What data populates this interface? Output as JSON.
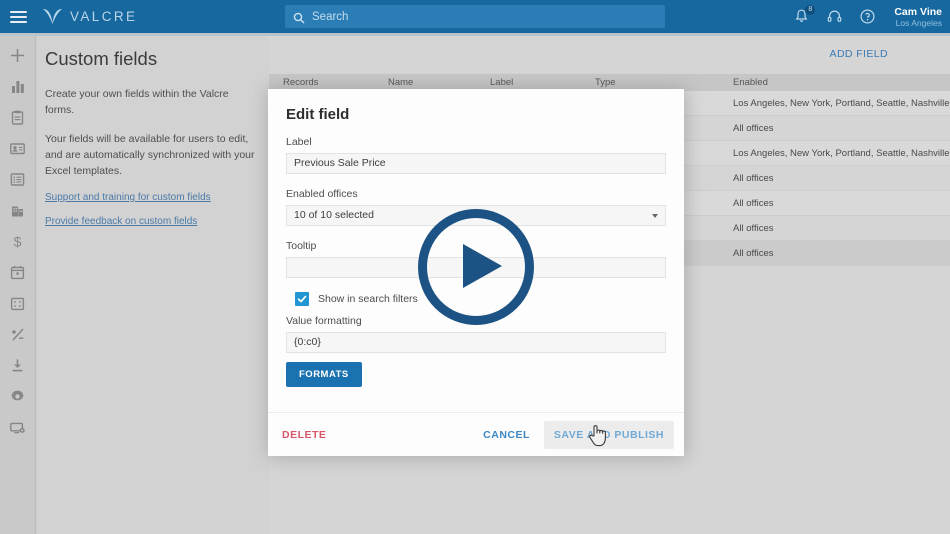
{
  "header": {
    "menu_icon": "hamburger-icon",
    "brand": "VALCRE",
    "search": {
      "placeholder": "Search",
      "icon": "search-icon"
    },
    "notifications": {
      "icon": "bell-icon",
      "count": "8"
    },
    "support_icon": "headset-icon",
    "help_icon": "help-circle-icon",
    "user": {
      "name": "Cam Vine",
      "office": "Los Angeles"
    },
    "bg_color": "#17689f"
  },
  "rail": {
    "items": [
      {
        "icon": "plus-icon",
        "name": "add"
      },
      {
        "icon": "bar-chart-icon",
        "name": "dashboard"
      },
      {
        "icon": "clipboard-icon",
        "name": "jobs"
      },
      {
        "icon": "contact-card-icon",
        "name": "contacts"
      },
      {
        "icon": "list-icon",
        "name": "records"
      },
      {
        "icon": "building-icon",
        "name": "properties"
      },
      {
        "icon": "dollar-icon",
        "name": "comparables"
      },
      {
        "icon": "calendar-icon",
        "name": "schedule"
      },
      {
        "icon": "table-grid-icon",
        "name": "data-grid"
      },
      {
        "icon": "plus-minus-icon",
        "name": "calculator"
      },
      {
        "icon": "download-icon",
        "name": "downloads"
      },
      {
        "icon": "gear-icon",
        "name": "settings"
      },
      {
        "icon": "monitor-gear-icon",
        "name": "admin"
      }
    ]
  },
  "left_panel": {
    "title": "Custom fields",
    "paragraph1": "Create your own fields within the Valcre forms.",
    "paragraph2": "Your fields will be available for users to edit, and are automatically synchronized with your Excel templates.",
    "link1": "Support and training for custom fields",
    "link2": "Provide feedback on custom fields"
  },
  "content": {
    "add_field_label": "ADD FIELD",
    "columns": [
      "Records",
      "Name",
      "Label",
      "Type",
      "Enabled"
    ],
    "rows": [
      {
        "enabled": "Los Angeles, New York, Portland, Seattle, Nashville, Sta..."
      },
      {
        "enabled": "All offices"
      },
      {
        "enabled": "Los Angeles, New York, Portland, Seattle, Nashville, Sta..."
      },
      {
        "enabled": "All offices"
      },
      {
        "enabled": "All offices"
      },
      {
        "enabled": "All offices"
      },
      {
        "enabled": "All offices"
      }
    ]
  },
  "modal": {
    "title": "Edit field",
    "label_field": {
      "label": "Label",
      "value": "Previous Sale Price"
    },
    "enabled_offices": {
      "label": "Enabled offices",
      "value": "10 of 10 selected"
    },
    "tooltip_field": {
      "label": "Tooltip",
      "value": ""
    },
    "search_filters": {
      "label": "Show in search filters",
      "checked": true
    },
    "value_formatting": {
      "label": "Value formatting",
      "value": "{0:c0}"
    },
    "formats_button": "FORMATS",
    "delete_button": "DELETE",
    "cancel_button": "CANCEL",
    "save_button": "SAVE AND PUBLISH"
  },
  "overlay": {
    "play_icon": "play-button-icon",
    "color": "#1d5384"
  }
}
